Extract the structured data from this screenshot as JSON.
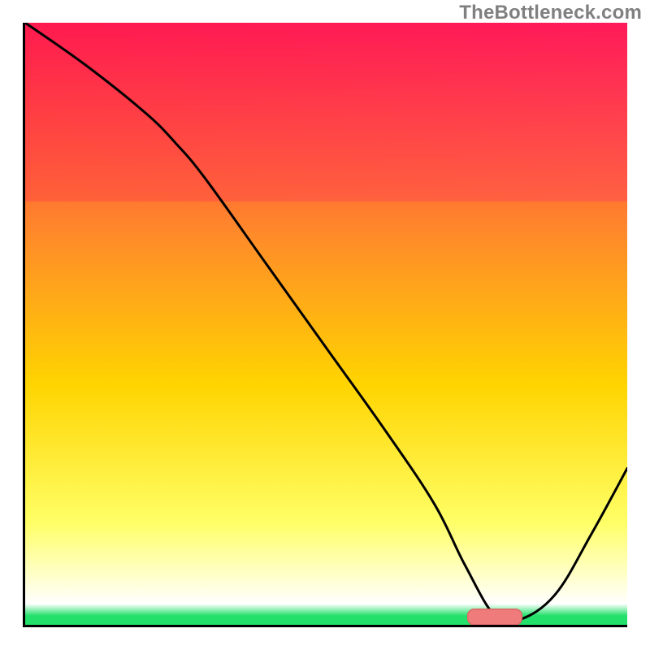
{
  "watermark": "TheBottleneck.com",
  "colors": {
    "axis": "#000000",
    "line": "#000000",
    "marker_fill": "#ef7b7b",
    "marker_stroke": "#e06666",
    "grad_top_left": "#ff1a4f",
    "grad_top_right": "#ff1a7a",
    "grad_mid_upper": "#ff8a2a",
    "grad_mid": "#ffd400",
    "grad_lower_yellow": "#ffff66",
    "grad_pale_yellow": "#ffffcc",
    "grad_green": "#22e06a",
    "white": "#ffffff"
  },
  "chart_data": {
    "type": "line",
    "title": "",
    "xlabel": "",
    "ylabel": "",
    "xlim": [
      0,
      100
    ],
    "ylim": [
      0,
      100
    ],
    "legend": false,
    "grid": false,
    "series": [
      {
        "name": "curve",
        "x": [
          0,
          10,
          20,
          25,
          30,
          40,
          50,
          60,
          68,
          73,
          78,
          82,
          88,
          94,
          100
        ],
        "y": [
          100,
          93,
          85,
          80,
          74,
          60,
          46,
          32,
          20,
          10,
          1.5,
          0.8,
          5,
          15,
          26
        ]
      }
    ],
    "marker": {
      "name": "optimal-range",
      "x_center": 78,
      "y": 1.3,
      "width": 9,
      "height": 2.6
    },
    "gradient_bands_pct_from_top": [
      {
        "at": 0,
        "color": "grad_top_left"
      },
      {
        "at": 35,
        "color": "grad_mid_upper"
      },
      {
        "at": 60,
        "color": "grad_mid"
      },
      {
        "at": 83,
        "color": "grad_lower_yellow"
      },
      {
        "at": 92,
        "color": "grad_pale_yellow"
      },
      {
        "at": 96.5,
        "color": "white"
      },
      {
        "at": 98.5,
        "color": "grad_green"
      },
      {
        "at": 100,
        "color": "grad_green"
      }
    ]
  }
}
